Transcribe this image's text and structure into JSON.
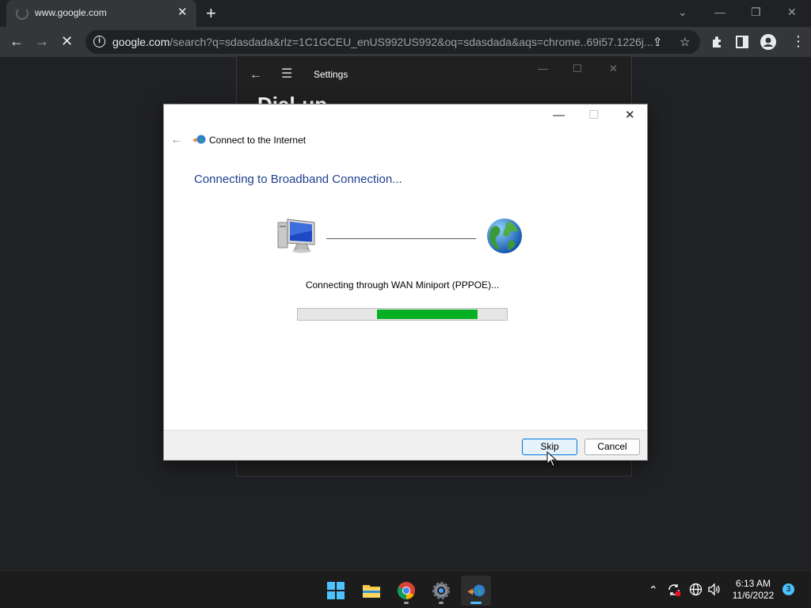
{
  "browser": {
    "tab_title": "www.google.com",
    "url_host": "google.com",
    "url_rest": "/search?q=sdasdada&rlz=1C1GCEU_enUS992US992&oq=sdasdada&aqs=chrome..69i57.1226j..."
  },
  "settings": {
    "title": "Settings",
    "heading": "Dial-up"
  },
  "dialog": {
    "app_title": "Connect to the Internet",
    "heading": "Connecting to Broadband Connection...",
    "status": "Connecting through WAN Miniport (PPPOE)...",
    "progress": {
      "start": 0.38,
      "end": 0.86
    },
    "skip_label": "Skip",
    "cancel_label": "Cancel"
  },
  "taskbar": {
    "apps": [
      "windows-start",
      "file-explorer",
      "chrome",
      "settings",
      "connect-to-internet"
    ],
    "time": "6:13 AM",
    "date": "11/6/2022",
    "notification_count": "3"
  },
  "colors": {
    "progress_fill": "#06b025",
    "heading": "#1f3f8f",
    "accent": "#4cc2ff"
  }
}
